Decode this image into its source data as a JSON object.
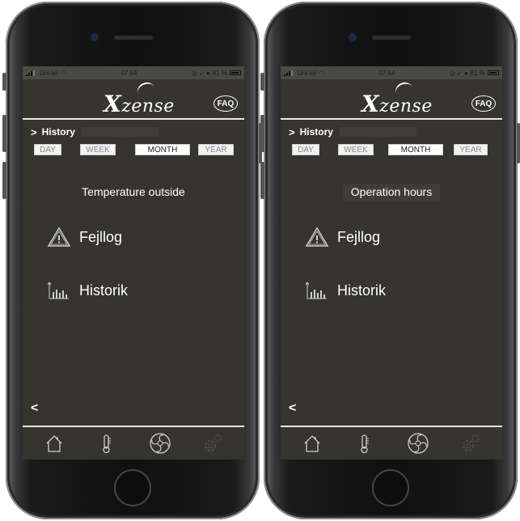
{
  "screens": [
    {
      "status": {
        "carrier": "Uni-tel",
        "time": "07.54",
        "battery": "81 %"
      },
      "brand": {
        "logo": "zense",
        "faq": "FAQ"
      },
      "breadcrumb": {
        "label": "History"
      },
      "periods": [
        {
          "label": "DAY",
          "active": false
        },
        {
          "label": "WEEK",
          "active": false
        },
        {
          "label": "MONTH",
          "active": true
        },
        {
          "label": "YEAR",
          "active": false
        }
      ],
      "title": "Temperature outside",
      "menu": [
        {
          "label": "Fejllog"
        },
        {
          "label": "Historik"
        }
      ],
      "back": "<",
      "tabs": [
        "home-icon",
        "thermometer-icon",
        "fan-icon",
        "settings-gear-icon"
      ]
    },
    {
      "status": {
        "carrier": "Uni-tel",
        "time": "07.54",
        "battery": "81 %"
      },
      "brand": {
        "logo": "zense",
        "faq": "FAQ"
      },
      "breadcrumb": {
        "label": "History"
      },
      "periods": [
        {
          "label": "DAY",
          "active": false
        },
        {
          "label": "WEEK",
          "active": false
        },
        {
          "label": "MONTH",
          "active": true
        },
        {
          "label": "YEAR",
          "active": false
        }
      ],
      "title": "Operation hours",
      "menu": [
        {
          "label": "Fejllog"
        },
        {
          "label": "Historik"
        }
      ],
      "back": "<",
      "tabs": [
        "home-icon",
        "thermometer-icon",
        "fan-icon",
        "settings-gear-icon"
      ]
    }
  ],
  "colors": {
    "screen_bg": "#353430",
    "text": "#ffffff",
    "divider": "#e8e8e8",
    "tab_inactive": "#5a5a55"
  }
}
